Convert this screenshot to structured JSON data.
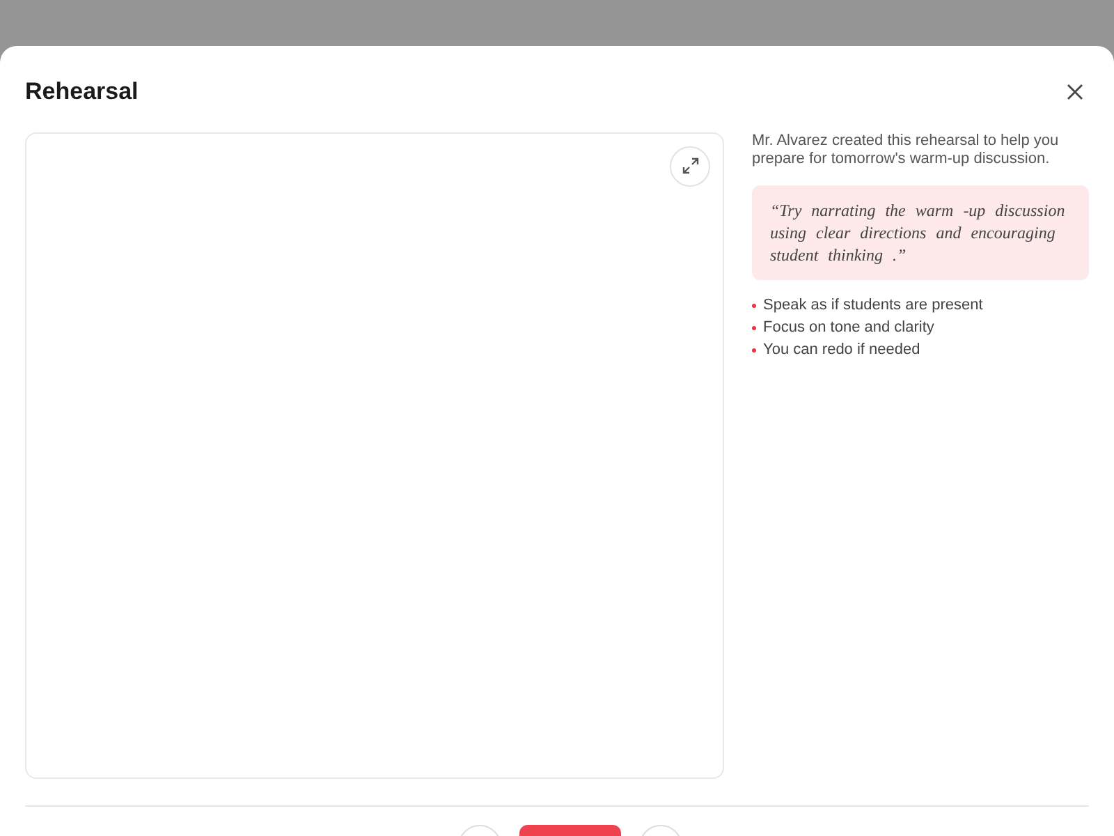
{
  "dialog": {
    "title": "Rehearsal"
  },
  "intro": "Mr. Alvarez created this rehearsal to help you prepare for tomorrow's warm-up discussion.",
  "quote": "“Try narrating the warm -up discussion using clear directions and encouraging student thinking .”",
  "tips": [
    "Speak as if students are present",
    "Focus on tone and clarity",
    "You can redo if needed"
  ]
}
